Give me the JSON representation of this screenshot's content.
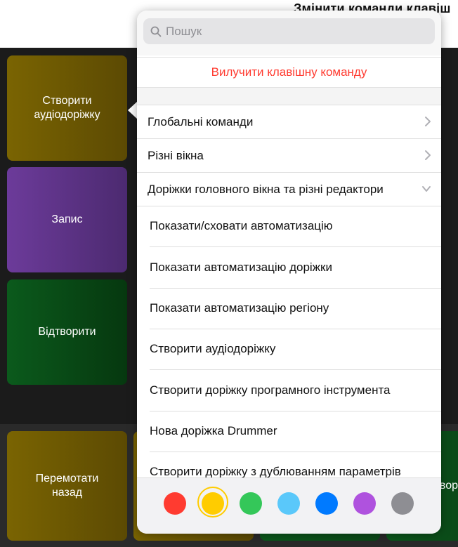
{
  "window": {
    "title": "Змінити команди клавіш"
  },
  "tiles": {
    "create_audio_track": "Створити аудіодоріжку",
    "record": "Запис",
    "play": "Відтворити",
    "rewind": "Перемотати назад",
    "partial_right": "вор"
  },
  "popover": {
    "search": {
      "placeholder": "Пошук"
    },
    "delete_label": "Вилучити клавішну команду",
    "categories": [
      {
        "label": "Глобальні команди",
        "state": "collapsed"
      },
      {
        "label": "Різні вікна",
        "state": "collapsed"
      },
      {
        "label": "Доріжки головного вікна та різні редактори",
        "state": "expanded"
      }
    ],
    "commands": [
      "Показати/сховати автоматизацію",
      "Показати автоматизацію доріжки",
      "Показати автоматизацію регіону",
      "Створити аудіодоріжку",
      "Створити доріжку програмного інструмента",
      "Нова доріжка Drummer",
      "Створити доріжку з дублюванням параметрів"
    ],
    "colors": [
      {
        "name": "red",
        "hex": "#ff3b30"
      },
      {
        "name": "yellow",
        "hex": "#ffcc00",
        "selected": true
      },
      {
        "name": "green",
        "hex": "#34c759"
      },
      {
        "name": "light-blue",
        "hex": "#5ac8fa"
      },
      {
        "name": "blue",
        "hex": "#007aff"
      },
      {
        "name": "purple",
        "hex": "#af52de"
      },
      {
        "name": "gray",
        "hex": "#8e8e93"
      }
    ]
  }
}
